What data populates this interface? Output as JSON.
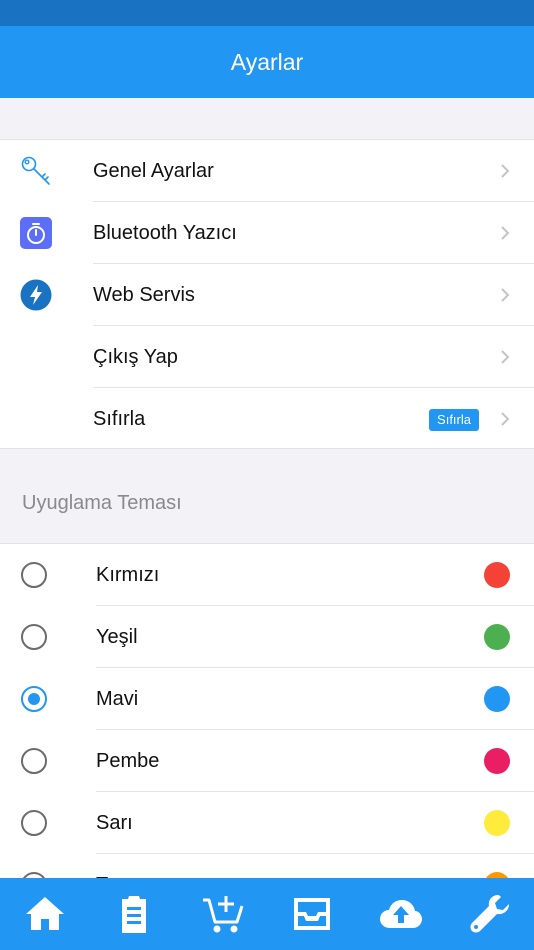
{
  "header": {
    "title": "Ayarlar"
  },
  "settings": {
    "items": [
      {
        "label": "Genel Ayarlar",
        "icon": "key-icon"
      },
      {
        "label": "Bluetooth Yazıcı",
        "icon": "stopwatch-icon"
      },
      {
        "label": "Web Servis",
        "icon": "lightning-icon"
      },
      {
        "label": "Çıkış Yap",
        "icon": ""
      },
      {
        "label": "Sıfırla",
        "icon": "",
        "badge": "Sıfırla"
      }
    ]
  },
  "theme": {
    "header": "Uyuglama Teması",
    "selected": "Mavi",
    "options": [
      {
        "label": "Kırmızı",
        "color": "#f44336"
      },
      {
        "label": "Yeşil",
        "color": "#4caf50"
      },
      {
        "label": "Mavi",
        "color": "#2196f3"
      },
      {
        "label": "Pembe",
        "color": "#e91e63"
      },
      {
        "label": "Sarı",
        "color": "#ffeb3b"
      },
      {
        "label": "Turuncu",
        "color": "#ff9800"
      }
    ]
  },
  "colors": {
    "primary": "#2196f3",
    "status_bar": "#1a72c2"
  },
  "tabbar": {
    "tabs": [
      {
        "name": "home-icon"
      },
      {
        "name": "clipboard-icon"
      },
      {
        "name": "add-cart-icon"
      },
      {
        "name": "inbox-tray-icon"
      },
      {
        "name": "cloud-upload-icon"
      },
      {
        "name": "wrench-icon"
      }
    ]
  }
}
